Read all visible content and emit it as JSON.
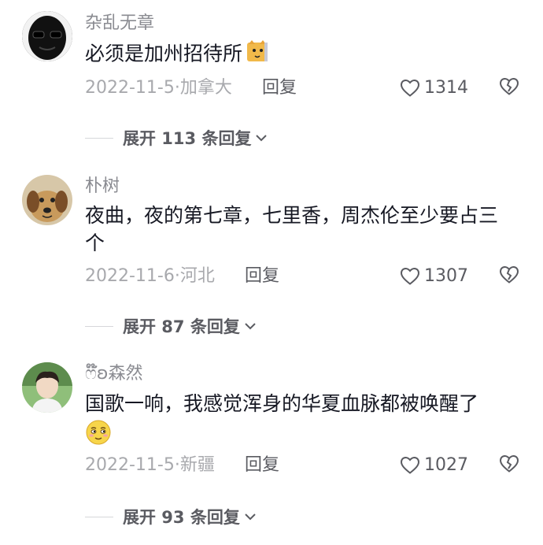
{
  "comments": [
    {
      "username": "杂乱无章",
      "text": "必须是加州招待所",
      "date": "2022-11-5",
      "location": "加拿大",
      "reply_label": "回复",
      "likes": "1314",
      "expand_label": "展开 113 条回复"
    },
    {
      "username": "朴树",
      "text": "夜曲，夜的第七章，七里香，周杰伦至少要占三个",
      "date": "2022-11-6",
      "location": "河北",
      "reply_label": "回复",
      "likes": "1307",
      "expand_label": "展开 87 条回复"
    },
    {
      "username": "ෆ໊໊⃛ʚ森然",
      "text": "国歌一响，我感觉浑身的华夏血脉都被唤醒了",
      "date": "2022-11-5",
      "location": "新疆",
      "reply_label": "回复",
      "likes": "1027",
      "expand_label": "展开 93 条回复"
    }
  ],
  "separator": "·",
  "icons": [
    "heart-icon",
    "broken-heart-icon",
    "chevron-down-icon",
    "cat-emoji-icon",
    "smirk-emoji-icon"
  ]
}
